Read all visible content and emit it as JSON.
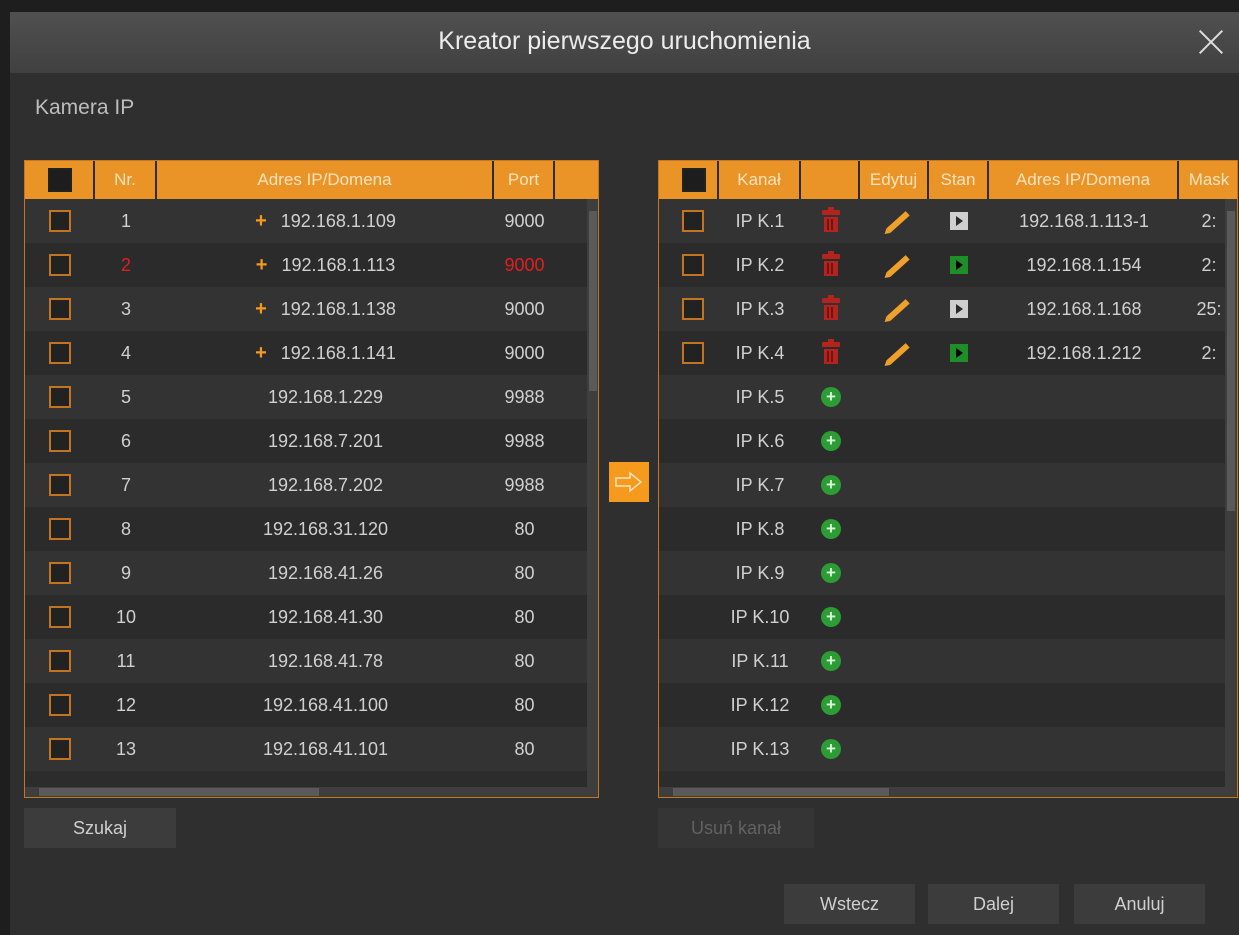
{
  "dialog": {
    "title": "Kreator pierwszego uruchomienia",
    "section_title": "Kamera IP"
  },
  "search_table": {
    "columns": {
      "nr": "Nr.",
      "address": "Adres IP/Domena",
      "port": "Port"
    },
    "rows": [
      {
        "nr": "1",
        "address": "192.168.1.109",
        "port": "9000",
        "added": true,
        "highlight": false
      },
      {
        "nr": "2",
        "address": "192.168.1.113",
        "port": "9000",
        "added": true,
        "highlight": true
      },
      {
        "nr": "3",
        "address": "192.168.1.138",
        "port": "9000",
        "added": true,
        "highlight": false
      },
      {
        "nr": "4",
        "address": "192.168.1.141",
        "port": "9000",
        "added": true,
        "highlight": false
      },
      {
        "nr": "5",
        "address": "192.168.1.229",
        "port": "9988",
        "added": false,
        "highlight": false
      },
      {
        "nr": "6",
        "address": "192.168.7.201",
        "port": "9988",
        "added": false,
        "highlight": false
      },
      {
        "nr": "7",
        "address": "192.168.7.202",
        "port": "9988",
        "added": false,
        "highlight": false
      },
      {
        "nr": "8",
        "address": "192.168.31.120",
        "port": "80",
        "added": false,
        "highlight": false
      },
      {
        "nr": "9",
        "address": "192.168.41.26",
        "port": "80",
        "added": false,
        "highlight": false
      },
      {
        "nr": "10",
        "address": "192.168.41.30",
        "port": "80",
        "added": false,
        "highlight": false
      },
      {
        "nr": "11",
        "address": "192.168.41.78",
        "port": "80",
        "added": false,
        "highlight": false
      },
      {
        "nr": "12",
        "address": "192.168.41.100",
        "port": "80",
        "added": false,
        "highlight": false
      },
      {
        "nr": "13",
        "address": "192.168.41.101",
        "port": "80",
        "added": false,
        "highlight": false
      }
    ],
    "plus_glyph": "+"
  },
  "channel_table": {
    "columns": {
      "channel": "Kanał",
      "edit": "Edytuj",
      "status": "Stan",
      "address": "Adres IP/Domena",
      "mask": "Mask"
    },
    "rows": [
      {
        "channel": "IP K.1",
        "assigned": true,
        "status": "gray",
        "address": "192.168.1.113-1",
        "mask": "2:"
      },
      {
        "channel": "IP K.2",
        "assigned": true,
        "status": "green",
        "address": "192.168.1.154",
        "mask": "2:"
      },
      {
        "channel": "IP K.3",
        "assigned": true,
        "status": "gray",
        "address": "192.168.1.168",
        "mask": "25:"
      },
      {
        "channel": "IP K.4",
        "assigned": true,
        "status": "green",
        "address": "192.168.1.212",
        "mask": "2:"
      },
      {
        "channel": "IP K.5",
        "assigned": false
      },
      {
        "channel": "IP K.6",
        "assigned": false
      },
      {
        "channel": "IP K.7",
        "assigned": false
      },
      {
        "channel": "IP K.8",
        "assigned": false
      },
      {
        "channel": "IP K.9",
        "assigned": false
      },
      {
        "channel": "IP K.10",
        "assigned": false
      },
      {
        "channel": "IP K.11",
        "assigned": false
      },
      {
        "channel": "IP K.12",
        "assigned": false
      },
      {
        "channel": "IP K.13",
        "assigned": false
      }
    ],
    "add_glyph": "+"
  },
  "buttons": {
    "search": "Szukaj",
    "remove_channel": "Usuń kanał",
    "back": "Wstecz",
    "next": "Dalej",
    "cancel": "Anuluj"
  },
  "colors": {
    "accent": "#ea9428",
    "highlight_text": "#e21f1f",
    "status_online": "#1d8f26",
    "status_offline": "#cfcfcf",
    "delete": "#b3241f",
    "add": "#2c9c35"
  }
}
